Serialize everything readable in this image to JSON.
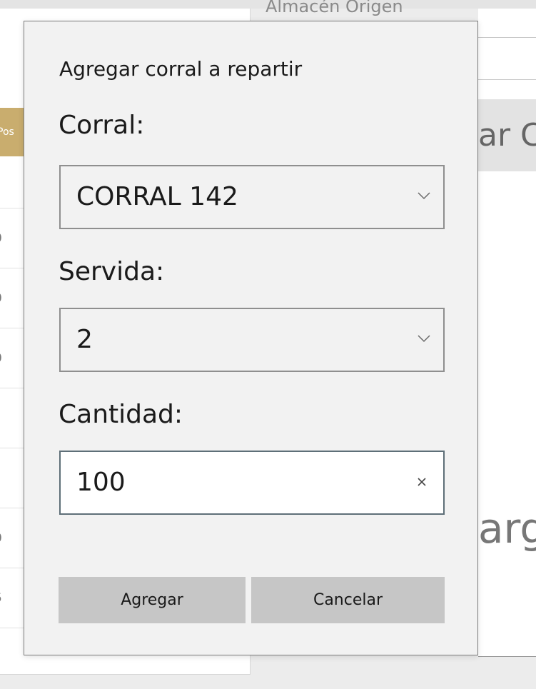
{
  "background": {
    "origin_label": "Almacén Origen",
    "left_header_text": "Pos",
    "left_rows": [
      "0",
      "0",
      "0",
      "",
      "",
      "0",
      "5"
    ],
    "right_button_text": "ar C",
    "right_big_text": "arg"
  },
  "dialog": {
    "title": "Agregar corral a repartir",
    "corral": {
      "label": "Corral:",
      "value": "CORRAL 142"
    },
    "servida": {
      "label": "Servida:",
      "value": "2"
    },
    "cantidad": {
      "label": "Cantidad:",
      "value": "100"
    },
    "buttons": {
      "agregar": "Agregar",
      "cancelar": "Cancelar"
    }
  },
  "icons": {
    "combo_arrow": "chevron-down-icon",
    "clear": "close-icon"
  },
  "colors": {
    "dialog_bg": "#f2f2f2",
    "button_bg": "#c6c6c6",
    "header_accent": "#c9ad6e"
  }
}
